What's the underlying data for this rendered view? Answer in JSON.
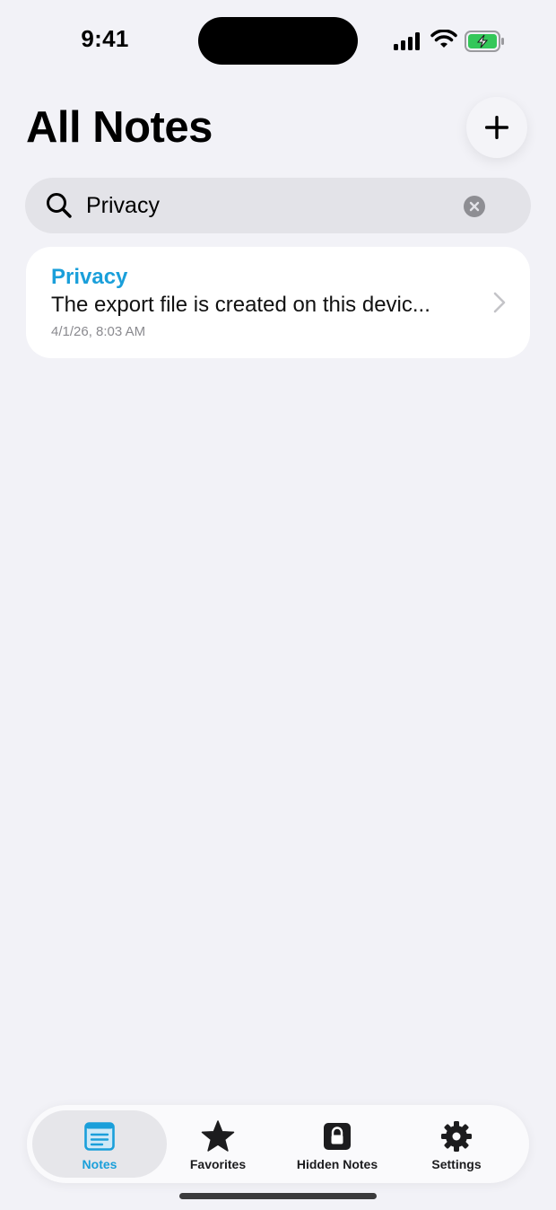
{
  "status_bar": {
    "time": "9:41"
  },
  "header": {
    "title": "All Notes",
    "add_icon": "plus-icon"
  },
  "search": {
    "value": "Privacy",
    "icon": "magnifying-glass-icon"
  },
  "notes": [
    {
      "title": "Privacy",
      "preview": "The export file is created on this devic...",
      "date": "4/1/26, 8:03 AM"
    }
  ],
  "tabs": [
    {
      "label": "Notes",
      "icon": "notes-icon",
      "active": true
    },
    {
      "label": "Favorites",
      "icon": "star-icon",
      "active": false
    },
    {
      "label": "Hidden Notes",
      "icon": "lock-icon",
      "active": false
    },
    {
      "label": "Settings",
      "icon": "gear-icon",
      "active": false
    }
  ],
  "colors": {
    "accent": "#1a9fda",
    "background": "#f2f2f7",
    "battery": "#34c759"
  }
}
